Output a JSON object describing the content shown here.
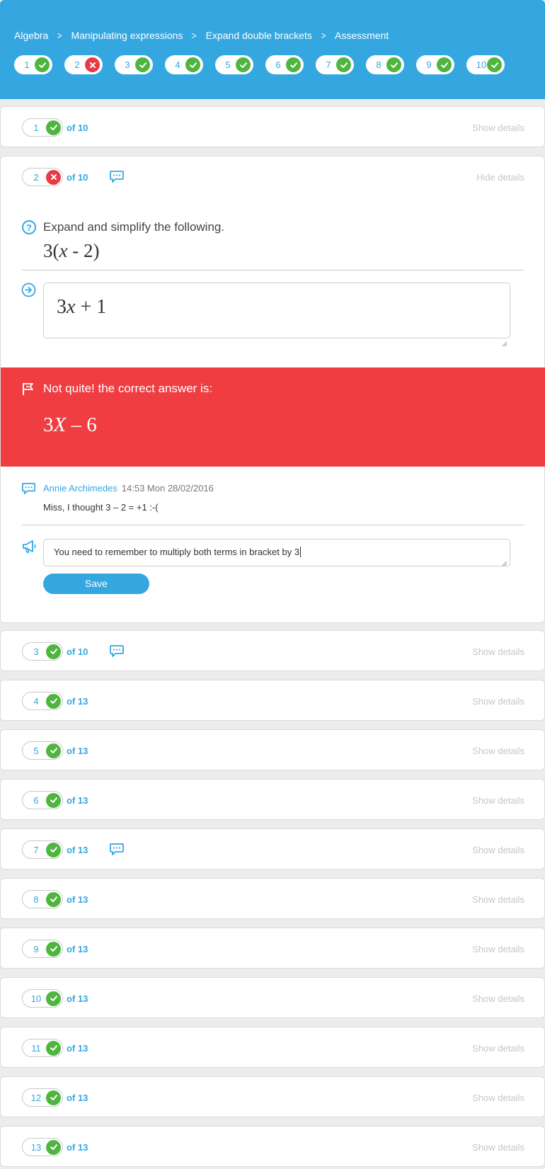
{
  "breadcrumb": [
    "Algebra",
    "Manipulating expressions",
    "Expand double brackets",
    "Assessment"
  ],
  "header_pills": [
    {
      "num": "1",
      "status": "correct"
    },
    {
      "num": "2",
      "status": "incorrect"
    },
    {
      "num": "3",
      "status": "correct"
    },
    {
      "num": "4",
      "status": "correct"
    },
    {
      "num": "5",
      "status": "correct"
    },
    {
      "num": "6",
      "status": "correct"
    },
    {
      "num": "7",
      "status": "correct"
    },
    {
      "num": "8",
      "status": "correct"
    },
    {
      "num": "9",
      "status": "correct"
    },
    {
      "num": "10",
      "status": "correct"
    }
  ],
  "labels": {
    "show_details": "Show details",
    "hide_details": "Hide details",
    "save": "Save"
  },
  "questions": [
    {
      "num": "1",
      "of": "of 10",
      "status": "correct",
      "comment": false
    },
    {
      "num": "2",
      "of": "of 10",
      "status": "incorrect",
      "comment": true
    },
    {
      "num": "3",
      "of": "of 10",
      "status": "correct",
      "comment": true
    },
    {
      "num": "4",
      "of": "of 13",
      "status": "correct",
      "comment": false
    },
    {
      "num": "5",
      "of": "of 13",
      "status": "correct",
      "comment": false
    },
    {
      "num": "6",
      "of": "of 13",
      "status": "correct",
      "comment": false
    },
    {
      "num": "7",
      "of": "of 13",
      "status": "correct",
      "comment": true
    },
    {
      "num": "8",
      "of": "of 13",
      "status": "correct",
      "comment": false
    },
    {
      "num": "9",
      "of": "of 13",
      "status": "correct",
      "comment": false
    },
    {
      "num": "10",
      "of": "of 13",
      "status": "correct",
      "comment": false
    },
    {
      "num": "11",
      "of": "of 13",
      "status": "correct",
      "comment": false
    },
    {
      "num": "12",
      "of": "of 13",
      "status": "correct",
      "comment": false
    },
    {
      "num": "13",
      "of": "of 13",
      "status": "correct",
      "comment": false
    }
  ],
  "expanded": {
    "prompt": "Expand and simplify the following.",
    "expression": {
      "coef": "3(",
      "var": "x",
      "rest": " - 2)"
    },
    "student_answer": {
      "coef": "3",
      "var": "x",
      "rest": " + 1"
    },
    "feedback_title": "Not quite! the correct answer is:",
    "correct_answer": {
      "coef": "3",
      "var": "X",
      "rest": " – 6"
    },
    "comment": {
      "author": "Annie Archimedes",
      "time": "14:53 Mon 28/02/2016",
      "text": "Miss, I thought 3 – 2 = +1 :-("
    },
    "reply_text": "You  need to remember to multiply both terms in bracket by 3"
  },
  "colors": {
    "brand": "#35a7e0",
    "correct": "#4fb53f",
    "incorrect": "#e73b45",
    "feedback_bg": "#ef3d42"
  }
}
